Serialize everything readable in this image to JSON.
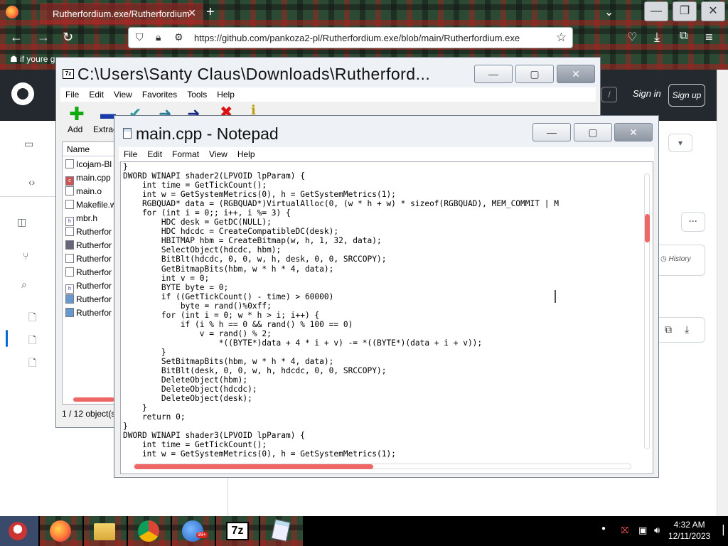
{
  "browser": {
    "tab_title": "Rutherfordium.exe/Rutherfordium",
    "tab_close": "✕",
    "new_tab": "+",
    "url": "https://github.com/pankoza2-pl/Rutherfordium.exe/blob/main/Rutherfordium.exe",
    "bookmark": "if youre g"
  },
  "github": {
    "sign_in": "Sign in",
    "sign_up": "Sign up",
    "slash_key": "/",
    "history": "History",
    "more": "···",
    "dropdown": "▾"
  },
  "sevenzip": {
    "title": "C:\\Users\\Santy Claus\\Downloads\\Rutherford...",
    "menu": [
      "File",
      "Edit",
      "View",
      "Favorites",
      "Tools",
      "Help"
    ],
    "toolbar": [
      "Add",
      "Extrac"
    ],
    "column_name": "Name",
    "files": [
      "Icojam-Bl",
      "main.cpp",
      "main.o",
      "Makefile.w",
      "mbr.h",
      "Rutherfor",
      "Rutherfor",
      "Rutherfor",
      "Rutherfor",
      "Rutherfor",
      "Rutherfor",
      "Rutherfor"
    ],
    "status": "1 / 12 object(s"
  },
  "notepad": {
    "title": "main.cpp - Notepad",
    "menu": [
      "File",
      "Edit",
      "Format",
      "View",
      "Help"
    ],
    "code": "}\nDWORD WINAPI shader2(LPVOID lpParam) {\n    int time = GetTickCount();\n    int w = GetSystemMetrics(0), h = GetSystemMetrics(1);\n    RGBQUAD* data = (RGBQUAD*)VirtualAlloc(0, (w * h + w) * sizeof(RGBQUAD), MEM_COMMIT | M\n    for (int i = 0;; i++, i %= 3) {\n        HDC desk = GetDC(NULL);\n        HDC hdcdc = CreateCompatibleDC(desk);\n        HBITMAP hbm = CreateBitmap(w, h, 1, 32, data);\n        SelectObject(hdcdc, hbm);\n        BitBlt(hdcdc, 0, 0, w, h, desk, 0, 0, SRCCOPY);\n        GetBitmapBits(hbm, w * h * 4, data);\n        int v = 0;\n        BYTE byte = 0;\n        if ((GetTickCount() - time) > 60000)\n            byte = rand()%0xff;\n        for (int i = 0; w * h > i; i++) {\n            if (i % h == 0 && rand() % 100 == 0)\n                v = rand() % 2;\n                    *((BYTE*)data + 4 * i + v) -= *((BYTE*)(data + i + v));\n        }\n        SetBitmapBits(hbm, w * h * 4, data);\n        BitBlt(desk, 0, 0, w, h, hdcdc, 0, 0, SRCCOPY);\n        DeleteObject(hbm);\n        DeleteObject(hdcdc);\n        DeleteObject(desk);\n    }\n    return 0;\n}\nDWORD WINAPI shader3(LPVOID lpParam) {\n    int time = GetTickCount();\n    int w = GetSystemMetrics(0), h = GetSystemMetrics(1);"
  },
  "taskbar": {
    "clock_time": "4:32 AM",
    "clock_date": "12/11/2023",
    "badge": "99+",
    "sevenzip_label": "7z"
  },
  "colors": {
    "accent_red": "#e05555",
    "github_header": "#24292f"
  }
}
